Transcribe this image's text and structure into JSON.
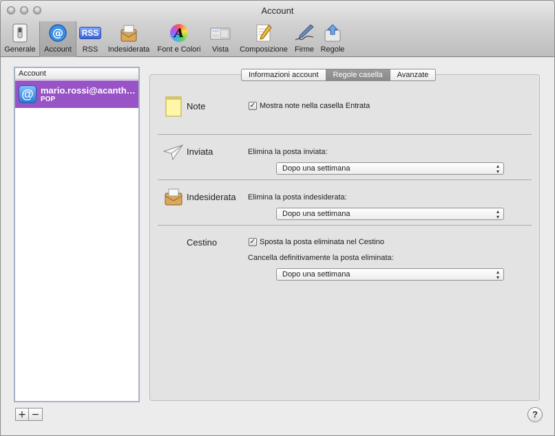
{
  "window": {
    "title": "Account"
  },
  "toolbar": {
    "items": [
      {
        "label": "Generale",
        "icon": "switch-icon"
      },
      {
        "label": "Account",
        "icon": "at-icon",
        "active": true
      },
      {
        "label": "RSS",
        "icon": "rss-icon"
      },
      {
        "label": "Indesiderata",
        "icon": "junk-mail-icon"
      },
      {
        "label": "Font e Colori",
        "icon": "font-icon"
      },
      {
        "label": "Vista",
        "icon": "view-icon"
      },
      {
        "label": "Composizione",
        "icon": "compose-icon"
      },
      {
        "label": "Firme",
        "icon": "signature-icon"
      },
      {
        "label": "Regole",
        "icon": "rules-icon"
      }
    ],
    "rss_glyph": "RSS",
    "font_glyph": "A"
  },
  "accounts": {
    "header": "Account",
    "items": [
      {
        "name": "mario.rossi@acanth…",
        "type": "POP",
        "icon_glyph": "@"
      }
    ],
    "add_label": "+",
    "remove_label": "−"
  },
  "tabs": [
    {
      "label": "Informazioni account",
      "active": false
    },
    {
      "label": "Regole casella",
      "active": true
    },
    {
      "label": "Avanzate",
      "active": false
    }
  ],
  "sections": {
    "note": {
      "title": "Note",
      "checkbox_label": "Mostra note nella casella Entrata",
      "checked": true
    },
    "sent": {
      "title": "Inviata",
      "label": "Elimina la posta inviata:",
      "value": "Dopo una settimana"
    },
    "junk": {
      "title": "Indesiderata",
      "label": "Elimina la posta indesiderata:",
      "value": "Dopo una settimana"
    },
    "trash": {
      "title": "Cestino",
      "checkbox_label": "Sposta la posta eliminata nel Cestino",
      "checked": true,
      "label": "Cancella definitivamente la posta eliminata:",
      "value": "Dopo una settimana"
    }
  },
  "help_label": "?",
  "colors": {
    "selection": "#9854c6",
    "list_border": "#a5b2c4",
    "accent_blue": "#2a7ad8"
  }
}
